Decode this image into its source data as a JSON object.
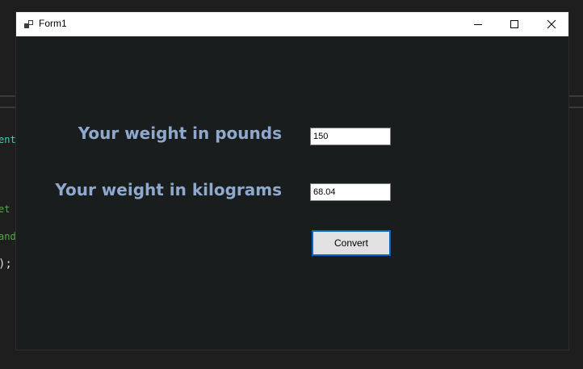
{
  "ide_background": {
    "code_fragments": [
      "ent.",
      "et (",
      "and",
      ");"
    ],
    "colors": {
      "teal": "#4ec9b0",
      "green": "#57a64a",
      "white": "#dcdcdc"
    }
  },
  "window": {
    "title": "Form1",
    "icon": "winforms-app-icon",
    "controls": [
      "minimize-icon",
      "maximize-icon",
      "close-icon"
    ]
  },
  "form": {
    "pounds_label": "Your weight in pounds",
    "pounds_value": "150",
    "kilograms_label": "Your weight in kilograms",
    "kilograms_value": "68.04",
    "convert_label": "Convert"
  },
  "colors": {
    "window_bg": "#1a1d1e",
    "label_color": "#8fa9cc",
    "button_border": "#0a64c8"
  }
}
